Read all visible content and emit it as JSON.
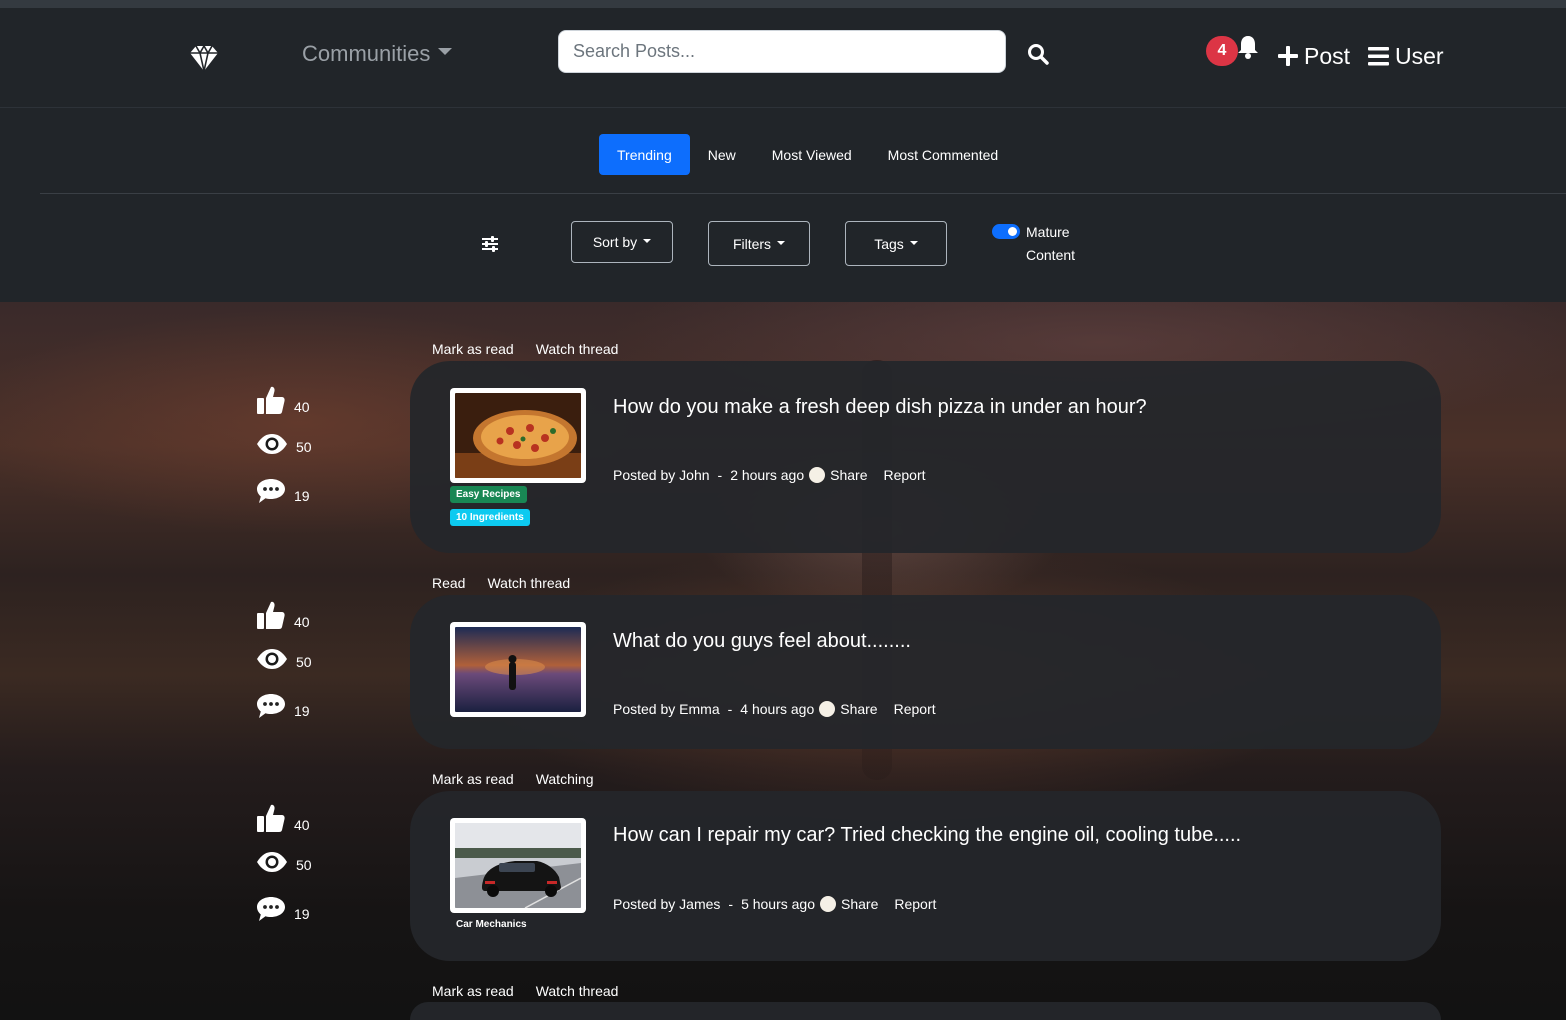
{
  "navbar": {
    "communities_label": "Communities",
    "search_placeholder": "Search Posts...",
    "notification_count": "4",
    "post_label": "Post",
    "user_label": "User"
  },
  "tabs": [
    {
      "label": "Trending",
      "active": true
    },
    {
      "label": "New",
      "active": false
    },
    {
      "label": "Most Viewed",
      "active": false
    },
    {
      "label": "Most Commented",
      "active": false
    }
  ],
  "filters": {
    "sort_label": "Sort by",
    "filters_label": "Filters",
    "tags_label": "Tags",
    "mature_label": "Mature Content",
    "mature_enabled": true
  },
  "posts": [
    {
      "actions": [
        "Mark as read",
        "Watch thread"
      ],
      "likes": "40",
      "views": "50",
      "comments": "19",
      "title": "How do you make a fresh deep dish pizza in under an hour?",
      "posted_by": "Posted by John",
      "time": "2 hours ago",
      "share": "Share",
      "report": "Report",
      "tags": [
        "Easy Recipes",
        "10 Ingredients"
      ]
    },
    {
      "actions": [
        "Read",
        "Watch thread"
      ],
      "likes": "40",
      "views": "50",
      "comments": "19",
      "title": "What do you guys feel about........",
      "posted_by": "Posted by Emma",
      "time": "4 hours ago",
      "share": "Share",
      "report": "Report",
      "tags": []
    },
    {
      "actions": [
        "Mark as read",
        "Watching"
      ],
      "likes": "40",
      "views": "50",
      "comments": "19",
      "title": "How can I repair my car? Tried checking the engine oil, cooling tube.....",
      "posted_by": "Posted by James",
      "time": "5 hours ago",
      "share": "Share",
      "report": "Report",
      "tags": [
        "Car Mechanics"
      ]
    },
    {
      "actions": [
        "Mark as read",
        "Watch thread"
      ]
    }
  ],
  "colors": {
    "accent": "#0d6efd",
    "badge": "#dc3545",
    "tag_green": "#198754",
    "tag_cyan": "#0dcaf0"
  }
}
